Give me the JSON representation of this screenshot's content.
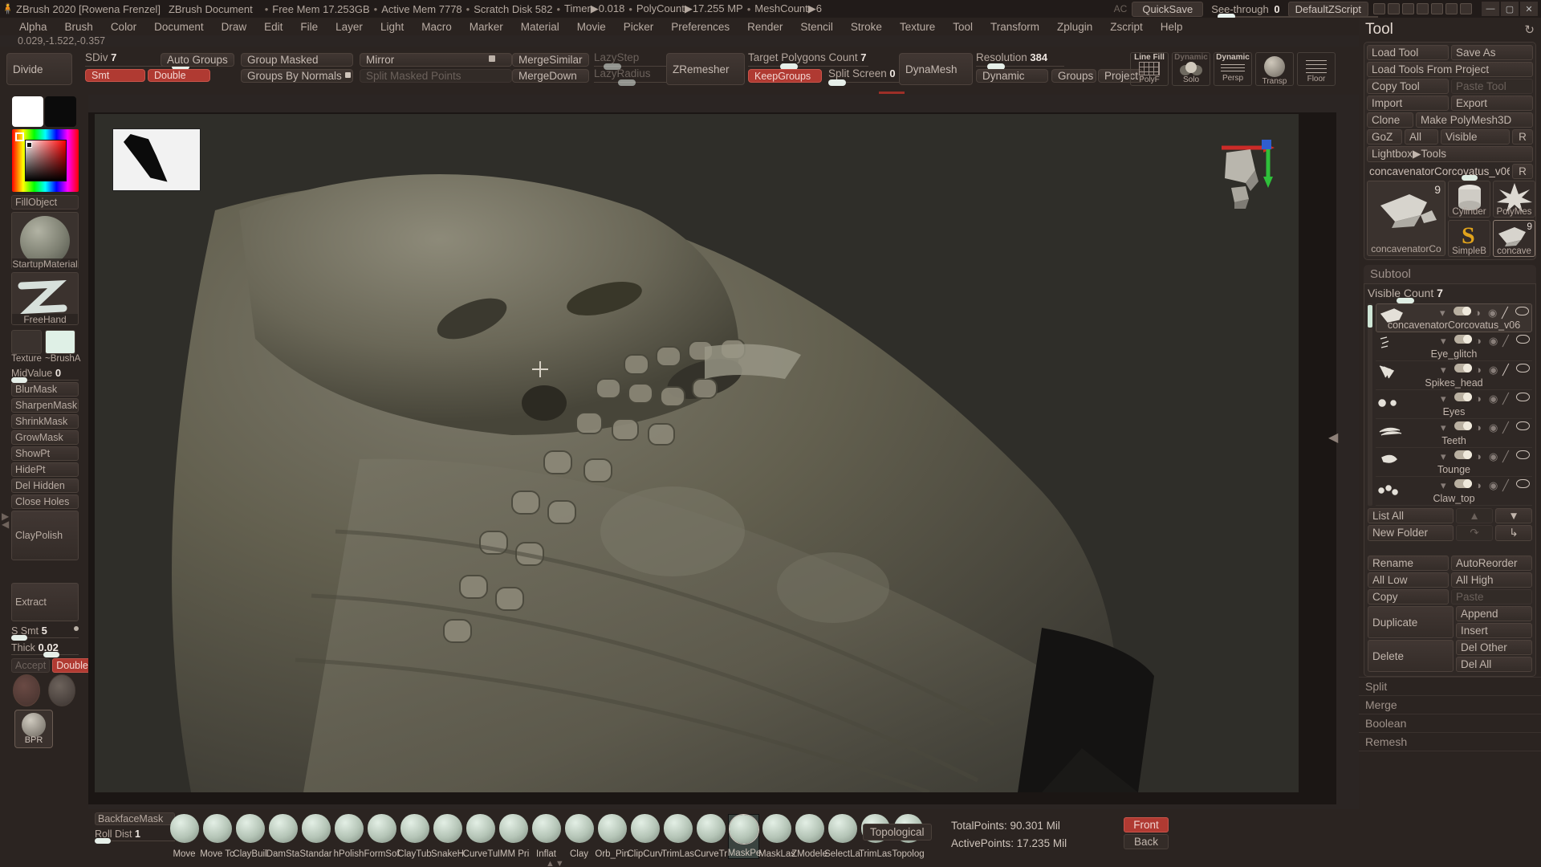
{
  "titlebar": {
    "app_title": "ZBrush 2020 [Rowena Frenzel]",
    "document": "ZBrush Document",
    "free_mem": "Free Mem 17.253GB",
    "active_mem": "Active Mem 7778",
    "scratch_disk": "Scratch Disk 582",
    "timer": "Timer▶0.018",
    "polycount": "PolyCount▶17.255 MP",
    "meshcount": "MeshCount▶6",
    "ac_label": "AC",
    "quicksave": "QuickSave",
    "seethrough_label": "See-through",
    "seethrough_value": "0",
    "defaultzscript": "DefaultZScript",
    "logo_icon": "zbrush-logo-icon",
    "minimize": "—",
    "maximize": "▢",
    "close": "✕"
  },
  "menu": {
    "items": [
      "Alpha",
      "Brush",
      "Color",
      "Document",
      "Draw",
      "Edit",
      "File",
      "Layer",
      "Light",
      "Macro",
      "Marker",
      "Material",
      "Movie",
      "Picker",
      "Preferences",
      "Render",
      "Stencil",
      "Stroke",
      "Texture",
      "Tool",
      "Transform",
      "Zplugin",
      "Zscript",
      "Help"
    ]
  },
  "coords": "0.029,-1.522,-0.357",
  "topshelf": {
    "divide": "Divide",
    "sdiv_label": "SDiv",
    "sdiv_value": "7",
    "smt": "Smt",
    "auto_groups": "Auto Groups",
    "double": "Double",
    "group_masked": "Group Masked",
    "groups_by_normals": "Groups By Normals",
    "mirror": "Mirror",
    "split_masked_points": "Split Masked Points",
    "merge_similar": "MergeSimilar",
    "merge_down": "MergeDown",
    "lazy_step": "LazyStep",
    "lazy_radius": "LazyRadius",
    "zremesher": "ZRemesher",
    "target_polygons_label": "Target Polygons Count",
    "target_polygons_value": "7",
    "keep_groups": "KeepGroups",
    "split_screen_label": "Split Screen",
    "split_screen_value": "0",
    "dynamesh": "DynaMesh",
    "resolution_label": "Resolution",
    "resolution_value": "384",
    "dynamic": "Dynamic",
    "groups": "Groups",
    "project": "Project",
    "line_fill": "Line Fill",
    "polyf": "PolyF",
    "dynamic_solo_top": "Dynamic",
    "solo": "Solo",
    "dynamic_persp_top": "Dynamic",
    "persp": "Persp",
    "transp": "Transp",
    "floor": "Floor"
  },
  "leftshelf": {
    "fill_object": "FillObject",
    "material_name": "StartupMaterial",
    "stroke_name": "FreeHand",
    "texture_label": "Texture",
    "alpha_label": "~BrushA",
    "midvalue_label": "MidValue",
    "midvalue_value": "0",
    "buttons": [
      "BlurMask",
      "SharpenMask",
      "ShrinkMask",
      "GrowMask",
      "ShowPt",
      "HidePt",
      "Del Hidden",
      "Close Holes"
    ],
    "claypolish": "ClayPolish",
    "extract": "Extract",
    "ssmt_label": "S Smt",
    "ssmt_value": "5",
    "thick_label": "Thick",
    "thick_value": "0.02",
    "accept": "Accept",
    "double": "Double",
    "bpr": "BPR"
  },
  "canvas": {
    "alpha_thumbnail": "alpha-thumbnail",
    "axis_gizmo": "axis-gizmo-icon",
    "nav_cube": "nav-head-thumbnail"
  },
  "rightpanel": {
    "title": "Tool",
    "reset_icon": "reset-icon",
    "load_tool": "Load Tool",
    "save_as": "Save As",
    "load_tools_from_project": "Load Tools From Project",
    "copy_tool": "Copy Tool",
    "paste_tool": "Paste Tool",
    "import": "Import",
    "export": "Export",
    "clone": "Clone",
    "make_polymesh3d": "Make PolyMesh3D",
    "goz": "GoZ",
    "all": "All",
    "visible": "Visible",
    "r": "R",
    "lightbox_tools": "Lightbox▶Tools",
    "current_tool_name": "concavenatorCorcovatus_v06",
    "tool_r": "R",
    "tool_thumbs": {
      "main_caption": "concavenatorCo",
      "main_badge": "9",
      "cylinder": "Cylinder",
      "polymesh": "PolyMes",
      "simplebrush": "SimpleB",
      "concave": "concave",
      "concave_badge": "9"
    },
    "subtool": {
      "header": "Subtool",
      "visible_count_label": "Visible Count",
      "visible_count_value": "7",
      "items": [
        {
          "name": "concavenatorCorcovatus_v06",
          "selected": true
        },
        {
          "name": "Eye_glitch",
          "selected": false
        },
        {
          "name": "Spikes_head",
          "selected": false
        },
        {
          "name": "Eyes",
          "selected": false
        },
        {
          "name": "Teeth",
          "selected": false
        },
        {
          "name": "Tounge",
          "selected": false
        },
        {
          "name": "Claw_top",
          "selected": false
        }
      ],
      "list_all": "List All",
      "new_folder": "New Folder",
      "up_arrow": "arrow-up-icon",
      "down_arrow": "arrow-down-icon",
      "folder_out": "folder-out-icon",
      "folder_in": "folder-in-icon",
      "rename": "Rename",
      "auto_reorder": "AutoReorder",
      "all_low": "All Low",
      "all_high": "All High",
      "copy": "Copy",
      "paste": "Paste",
      "duplicate": "Duplicate",
      "append": "Append",
      "insert": "Insert",
      "delete": "Delete",
      "del_other": "Del Other",
      "del_all": "Del All",
      "split": "Split",
      "merge": "Merge",
      "boolean": "Boolean",
      "remesh": "Remesh"
    }
  },
  "bottomshelf": {
    "backface_mask": "BackfaceMask",
    "roll_dist_label": "Roll Dist",
    "roll_dist_value": "1",
    "brushes": [
      {
        "name": "Move"
      },
      {
        "name": "Move Tc"
      },
      {
        "name": "ClayBuil"
      },
      {
        "name": "DamSta"
      },
      {
        "name": "Standar"
      },
      {
        "name": "hPolish"
      },
      {
        "name": "FormSof"
      },
      {
        "name": "ClayTub"
      },
      {
        "name": "SnakeH"
      },
      {
        "name": "CurveTu"
      },
      {
        "name": "IMM Pri"
      },
      {
        "name": "Inflat"
      },
      {
        "name": "Clay"
      },
      {
        "name": "Orb_Pin"
      },
      {
        "name": "ClipCurv"
      },
      {
        "name": "TrimLas"
      },
      {
        "name": "CurveTr"
      },
      {
        "name": "MaskPe",
        "selected": true
      },
      {
        "name": "MaskLas"
      },
      {
        "name": "ZModele"
      },
      {
        "name": "SelectLa"
      },
      {
        "name": "TrimLas"
      },
      {
        "name": "Topolog"
      }
    ],
    "topological": "Topological",
    "total_points": "TotalPoints: 90.301 Mil",
    "active_points": "ActivePoints: 17.235 Mil",
    "front": "Front",
    "back": "Back"
  },
  "colors": {
    "accent_red": "#b03a32",
    "panel_bg": "#2b2421",
    "button_bg": "#3a312d",
    "text": "#c2b6ad",
    "slider_knob": "#e6efe9"
  }
}
